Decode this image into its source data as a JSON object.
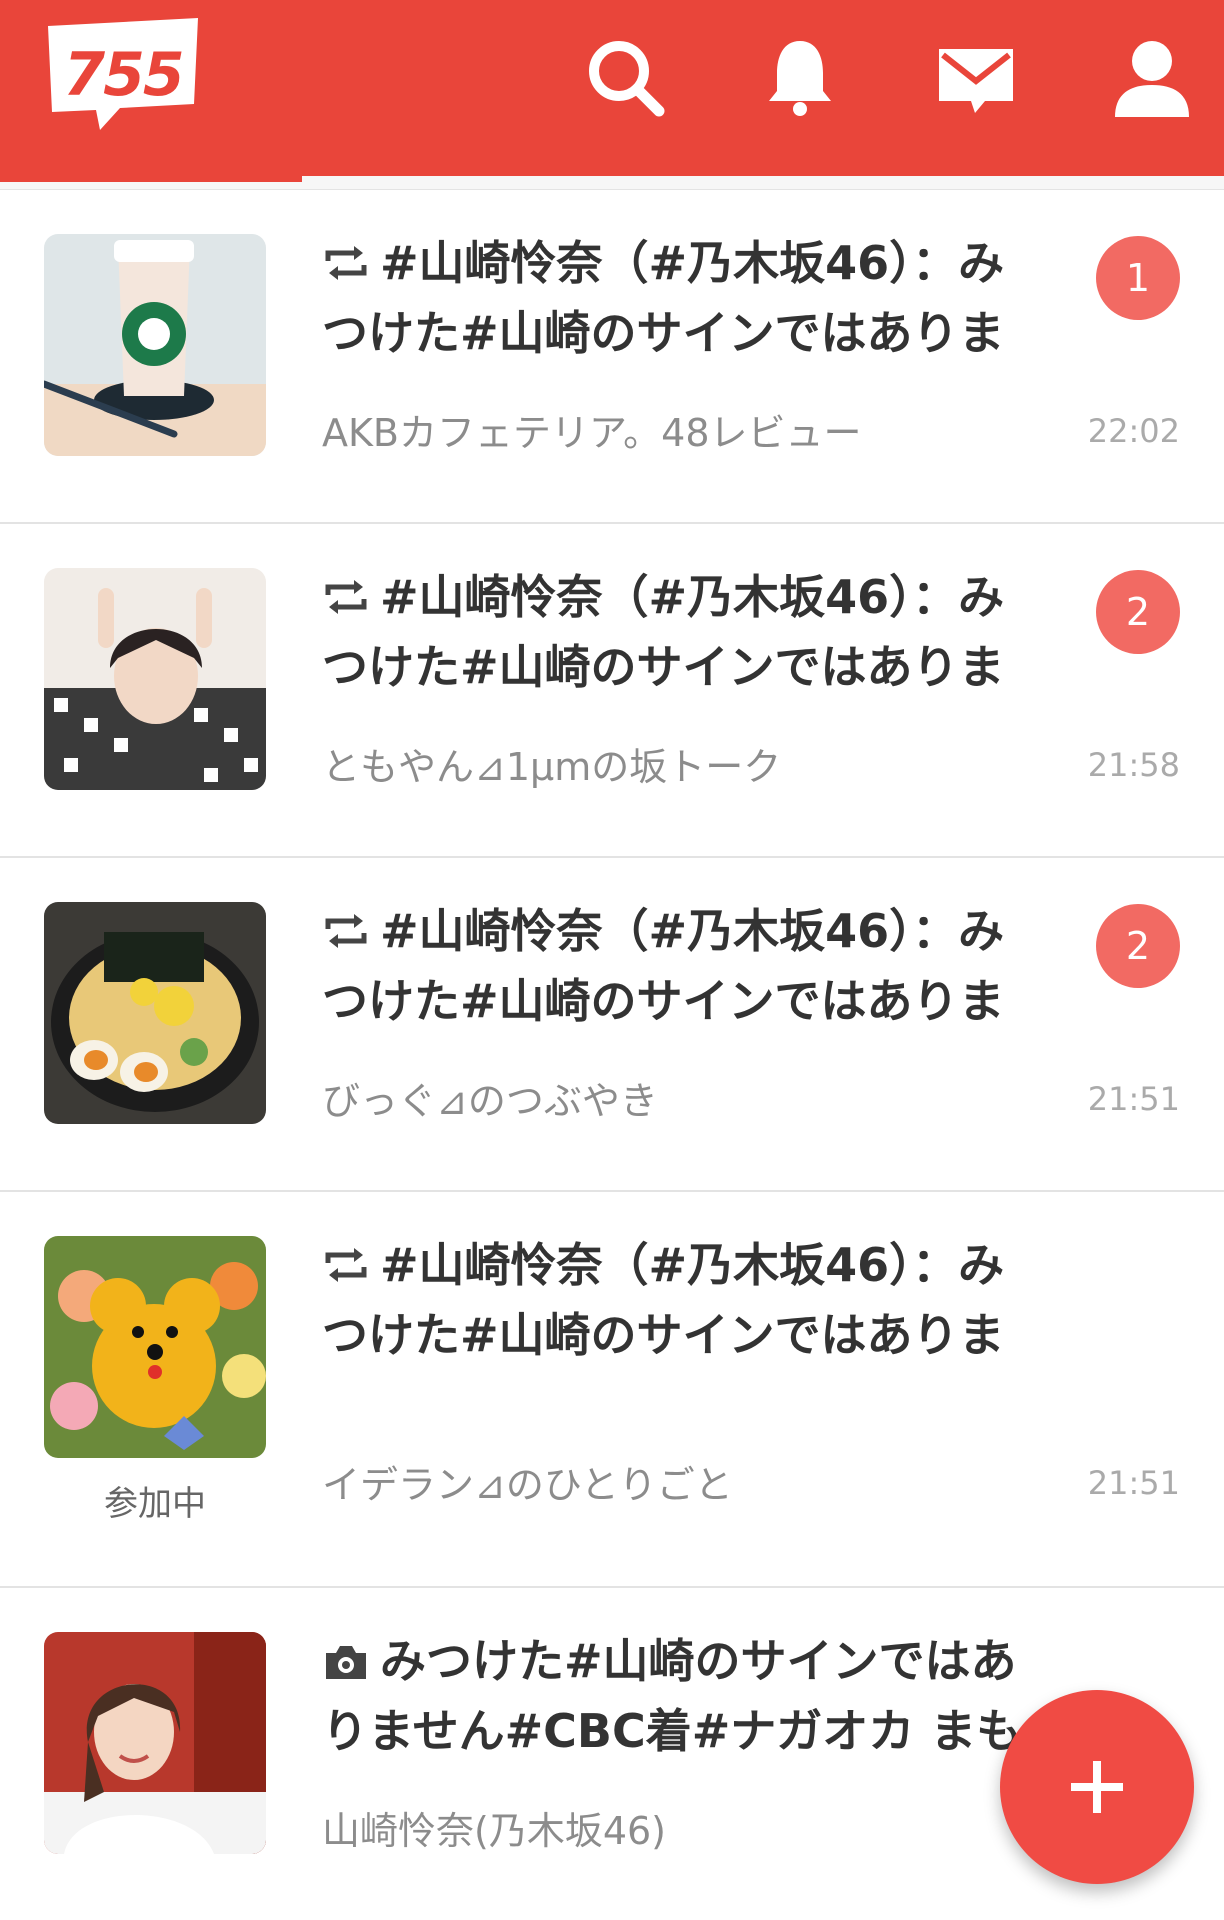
{
  "app": {
    "logo_text": "755",
    "accent_color": "#e9453a"
  },
  "header": {
    "icons": [
      "search-icon",
      "bell-icon",
      "mail-icon",
      "user-icon"
    ]
  },
  "feed": {
    "items": [
      {
        "icon": "repost-icon",
        "title": "#山崎怜奈（#乃木坂46）：みつけた#山崎のサインではありま",
        "subtitle": "AKBカフェテリア。48レビュー",
        "badge": "1",
        "time": "22:02",
        "thumb": "coffee-cup-photo"
      },
      {
        "icon": "repost-icon",
        "title": "#山崎怜奈（#乃木坂46）：みつけた#山崎のサインではありま",
        "subtitle": "ともやん⊿1μmの坂トーク",
        "badge": "2",
        "time": "21:58",
        "thumb": "person-photo"
      },
      {
        "icon": "repost-icon",
        "title": "#山崎怜奈（#乃木坂46）：みつけた#山崎のサインではありま",
        "subtitle": "びっぐ⊿のつぶやき",
        "badge": "2",
        "time": "21:51",
        "thumb": "ramen-photo"
      },
      {
        "icon": "repost-icon",
        "title": "#山崎怜奈（#乃木坂46）：みつけた#山崎のサインではありま",
        "subtitle": "イデラン⊿のひとりごと",
        "caption": "参加中",
        "time": "21:51",
        "thumb": "flower-dog-photo"
      },
      {
        "icon": "camera-icon",
        "title": "みつけた#山崎のサインではありません#CBC着#ナガオカ まも",
        "subtitle": "山崎怜奈(乃木坂46)",
        "thumb": "woman-photo"
      }
    ]
  },
  "fab": {
    "icon": "plus-icon"
  }
}
